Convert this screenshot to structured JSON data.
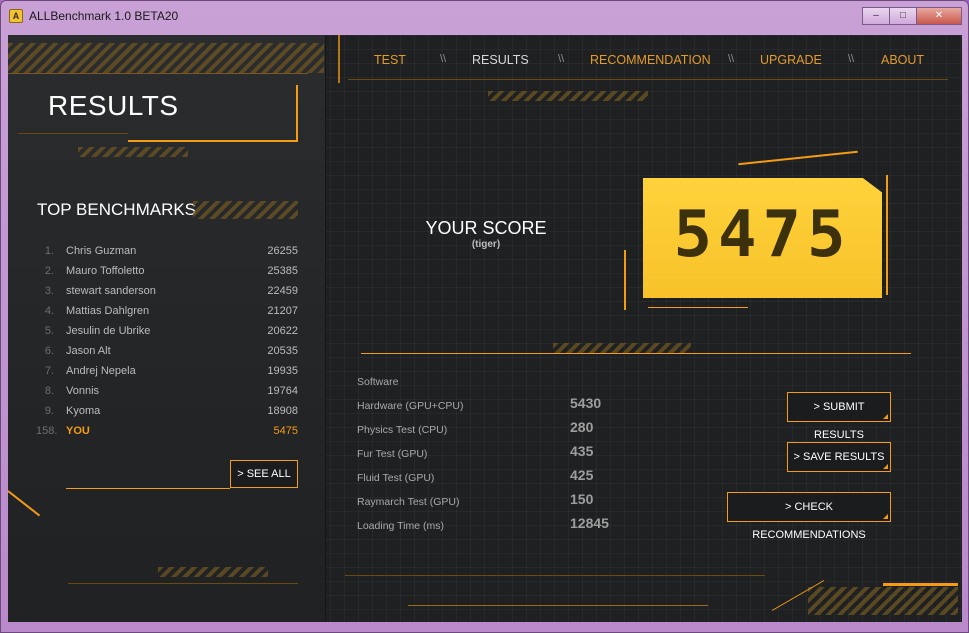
{
  "window": {
    "title": "ALLBenchmark 1.0 BETA20",
    "icon": "app-icon",
    "controls": {
      "minimize": "–",
      "maximize": "□",
      "close": "✕"
    }
  },
  "left": {
    "title": "RESULTS",
    "top_benchmarks_title": "TOP BENCHMARKS",
    "benchmarks": [
      {
        "rank": "1.",
        "name": "Chris Guzman",
        "score": "26255"
      },
      {
        "rank": "2.",
        "name": "Mauro Toffoletto",
        "score": "25385"
      },
      {
        "rank": "3.",
        "name": "stewart sanderson",
        "score": "22459"
      },
      {
        "rank": "4.",
        "name": "Mattias Dahlgren",
        "score": "21207"
      },
      {
        "rank": "5.",
        "name": "Jesulin de Ubrike",
        "score": "20622"
      },
      {
        "rank": "6.",
        "name": "Jason Alt",
        "score": "20535"
      },
      {
        "rank": "7.",
        "name": "Andrej Nepela",
        "score": "19935"
      },
      {
        "rank": "8.",
        "name": "Vonnis",
        "score": "19764"
      },
      {
        "rank": "9.",
        "name": "Kyoma",
        "score": "18908"
      }
    ],
    "you": {
      "rank": "158.",
      "name": "YOU",
      "score": "5475"
    },
    "see_all_label": "> SEE ALL"
  },
  "nav": {
    "items": [
      "TEST",
      "RESULTS",
      "RECOMMENDATION",
      "UPGRADE",
      "ABOUT"
    ],
    "separator": "\\\\",
    "active": "RESULTS"
  },
  "score": {
    "label": "YOUR SCORE",
    "user": "(tiger)",
    "value": "5475"
  },
  "stats": {
    "labels": [
      "Software",
      "Hardware (GPU+CPU)",
      "Physics Test (CPU)",
      "Fur Test (GPU)",
      "Fluid Test (GPU)",
      "Raymarch Test (GPU)",
      "Loading Time (ms)"
    ],
    "values": [
      "5430",
      "280",
      "435",
      "425",
      "150",
      "12845"
    ]
  },
  "actions": {
    "submit": "> SUBMIT RESULTS",
    "save": "> SAVE RESULTS",
    "check": "> CHECK RECOMMENDATIONS"
  },
  "colors": {
    "accent": "#f59b14",
    "score_box": "#ffd23b",
    "background": "#1e2022"
  }
}
